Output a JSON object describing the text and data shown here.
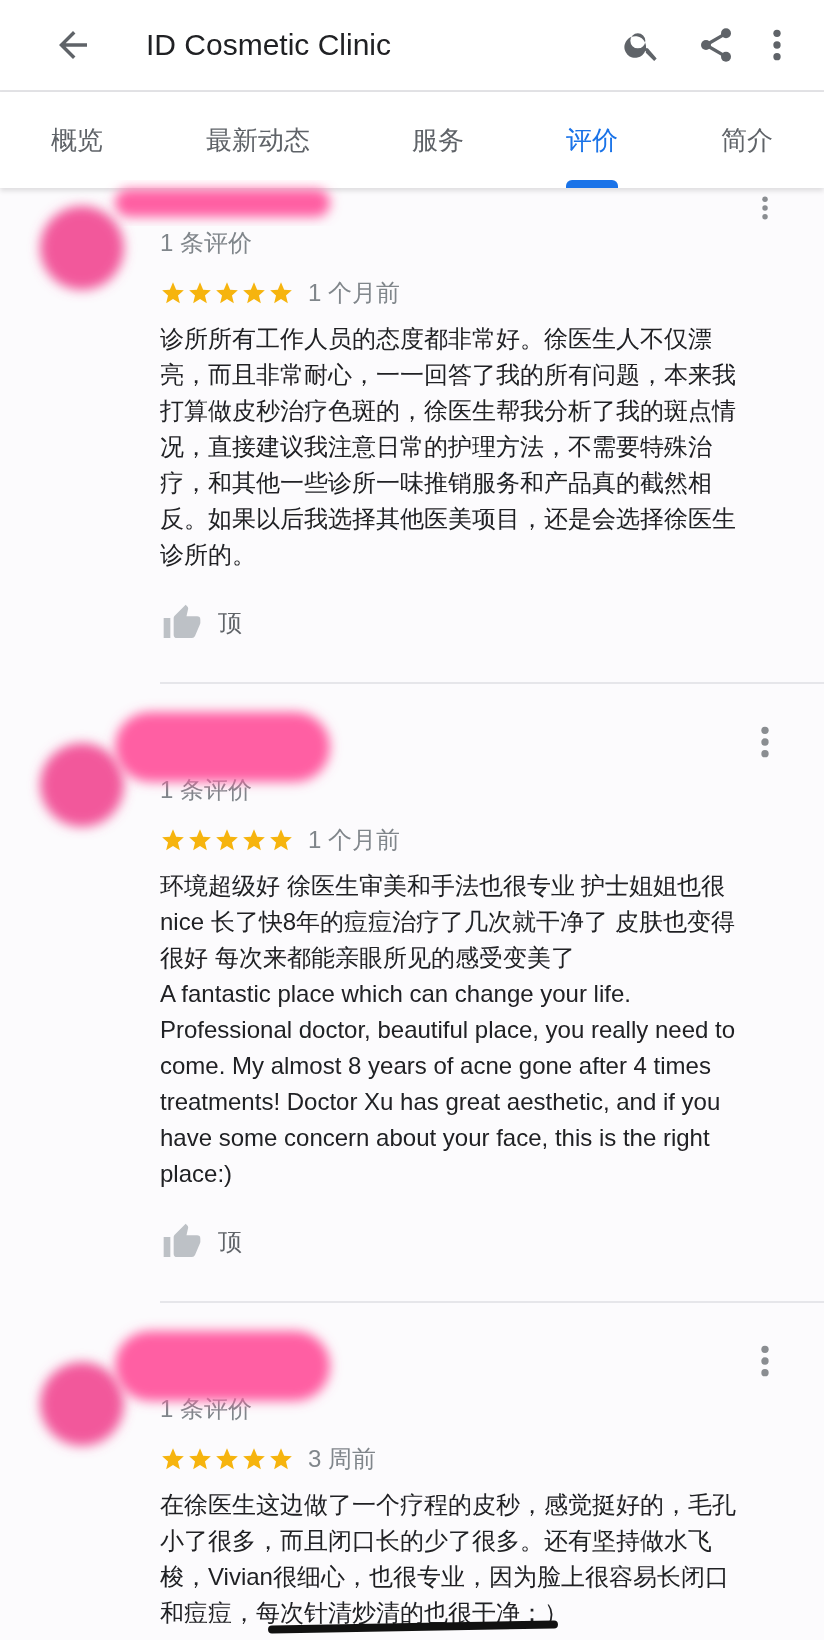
{
  "app_bar": {
    "title": "ID Cosmetic Clinic"
  },
  "tabs": [
    {
      "label": "概览",
      "selected": false
    },
    {
      "label": "最新动态",
      "selected": false
    },
    {
      "label": "服务",
      "selected": false
    },
    {
      "label": "评价",
      "selected": true
    },
    {
      "label": "简介",
      "selected": false
    }
  ],
  "reviews": [
    {
      "review_count": "1 条评价",
      "stars": 5,
      "time": "1 个月前",
      "text": "诊所所有工作人员的态度都非常好。徐医生人不仅漂亮，而且非常耐心，一一回答了我的所有问题，本来我打算做皮秒治疗色斑的，徐医生帮我分析了我的斑点情况，直接建议我注意日常的护理方法，不需要特殊治疗，和其他一些诊所一味推销服务和产品真的截然相反。如果以后我选择其他医美项目，还是会选择徐医生诊所的。",
      "like_label": "顶",
      "scribbled": false
    },
    {
      "review_count": "1 条评价",
      "stars": 5,
      "time": "1 个月前",
      "text": "环境超级好 徐医生审美和手法也很专业 护士姐姐也很nice 长了快8年的痘痘治疗了几次就干净了 皮肤也变得很好 每次来都能亲眼所见的感受变美了\nA fantastic place which can change your life. Professional doctor, beautiful place, you really need to come. My almost  8 years of acne gone after 4 times treatments! Doctor Xu has great aesthetic, and if you have some concern about your face, this is the right place:)",
      "like_label": "顶",
      "scribbled": false
    },
    {
      "review_count": "1 条评价",
      "stars": 5,
      "time": "3 周前",
      "text": "在徐医生这边做了一个疗程的皮秒，感觉挺好的，毛孔小了很多，而且闭口长的少了很多。还有坚持做水飞梭，Vivian很细心，也很专业，因为脸上很容易长闭口和痘痘，每次针清炒清的也很干净：）",
      "scribbled": true
    }
  ]
}
